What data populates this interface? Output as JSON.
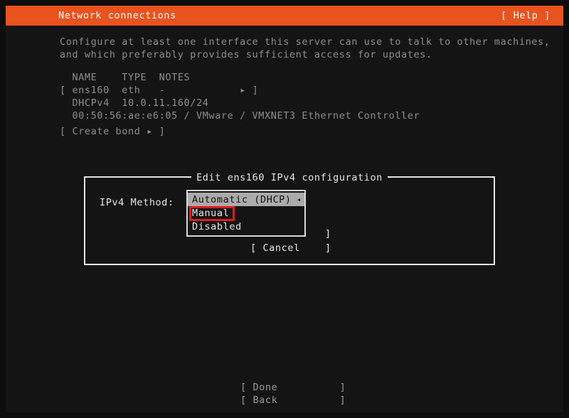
{
  "theme": {
    "header_bg": "#e8531f",
    "header_fg": "#ffffff",
    "screen_bg": "#0d0d0d",
    "terminal_bg": "#141414",
    "text_dim": "#8d8d8d",
    "text_bright": "#e6e6e6",
    "select_bg": "#ababab",
    "select_fg": "#101010",
    "annotation": "#e01b1b"
  },
  "header": {
    "title": "Network connections",
    "help": "[ Help ]"
  },
  "intro": {
    "line1": "Configure at least one interface this server can use to talk to other machines,",
    "line2": "and which preferably provides sufficient access for updates."
  },
  "interfaces": {
    "columns": "  NAME    TYPE  NOTES",
    "rows": [
      {
        "summary": "[ ens160  eth   -",
        "arrow": "▸",
        "close": "]",
        "detail1": "  DHCPv4  10.0.11.160/24",
        "detail2": "  00:50:56:ae:e6:05 / VMware / VMXNET3 Ethernet Controller"
      }
    ],
    "create_bond": "[ Create bond ▸ ]"
  },
  "dialog": {
    "title": "Edit ens160 IPv4 configuration",
    "method_label": "IPv4 Method:",
    "dropdown": {
      "name": "ipv4-method",
      "selected": "Automatic (DHCP)",
      "arrow": "◂",
      "options": [
        {
          "label": "Automatic (DHCP)",
          "selected": true
        },
        {
          "label": "Manual",
          "selected": false
        },
        {
          "label": "Disabled",
          "selected": false
        }
      ]
    },
    "save_bracket_close": "]",
    "cancel_label": "[ Cancel",
    "cancel_bracket_close": "]"
  },
  "footer": {
    "done": "[ Done          ]",
    "back": "[ Back          ]"
  }
}
